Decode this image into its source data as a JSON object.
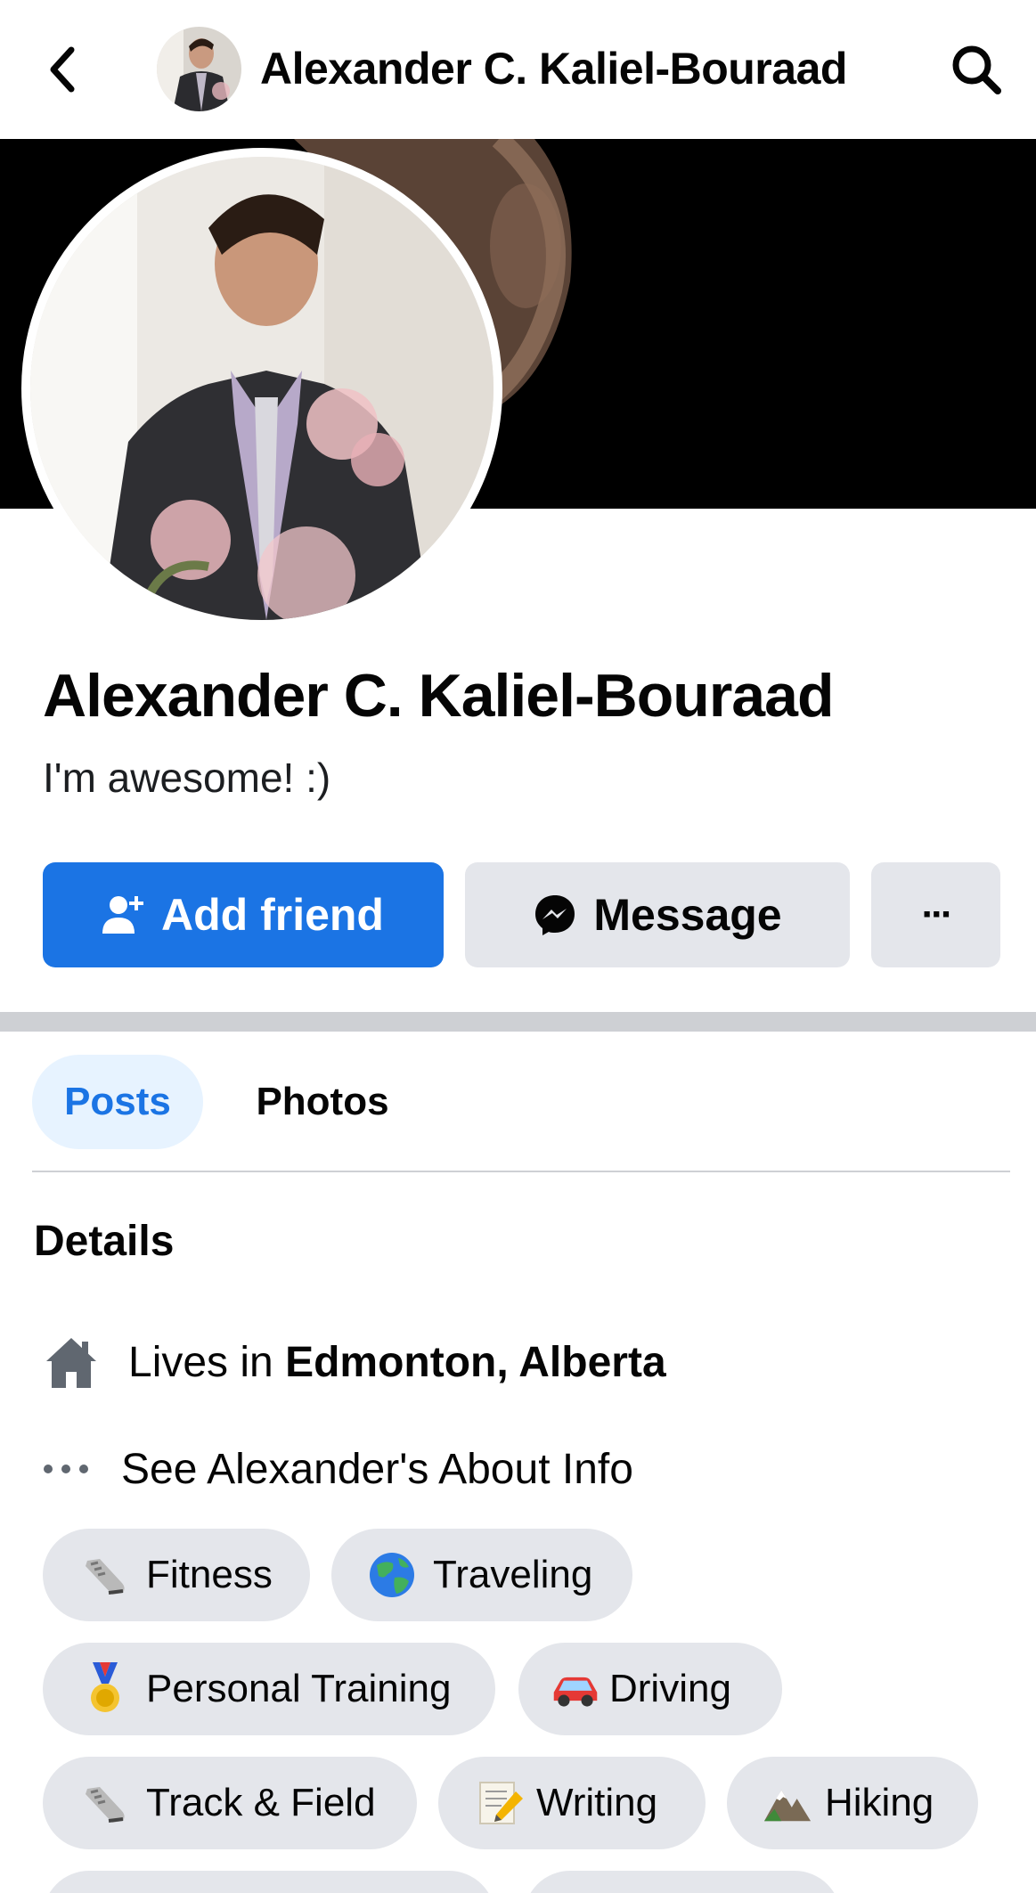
{
  "header": {
    "title": "Alexander C. Kaliel-Bouraad"
  },
  "profile": {
    "name": "Alexander C. Kaliel-Bouraad",
    "bio": "I'm awesome! :)"
  },
  "actions": {
    "add_friend": "Add friend",
    "message": "Message",
    "more": "···"
  },
  "tabs": [
    {
      "label": "Posts",
      "active": true
    },
    {
      "label": "Photos",
      "active": false
    }
  ],
  "details": {
    "title": "Details",
    "lives_prefix": "Lives in ",
    "lives_place": "Edmonton, Alberta",
    "about_link": "See Alexander's About Info"
  },
  "interests": [
    {
      "label": "Fitness",
      "icon": "sneaker-icon"
    },
    {
      "label": "Traveling",
      "icon": "globe-icon"
    },
    {
      "label": "Personal Training",
      "icon": "medal-icon"
    },
    {
      "label": "Driving",
      "icon": "car-icon"
    },
    {
      "label": "Track & Field",
      "icon": "sneaker-icon"
    },
    {
      "label": "Writing",
      "icon": "pencil-paper-icon"
    },
    {
      "label": "Hiking",
      "icon": "mountain-icon"
    }
  ],
  "colors": {
    "accent": "#1b74e4",
    "chip_bg": "#e4e6eb",
    "tab_active_bg": "#e7f3ff"
  }
}
